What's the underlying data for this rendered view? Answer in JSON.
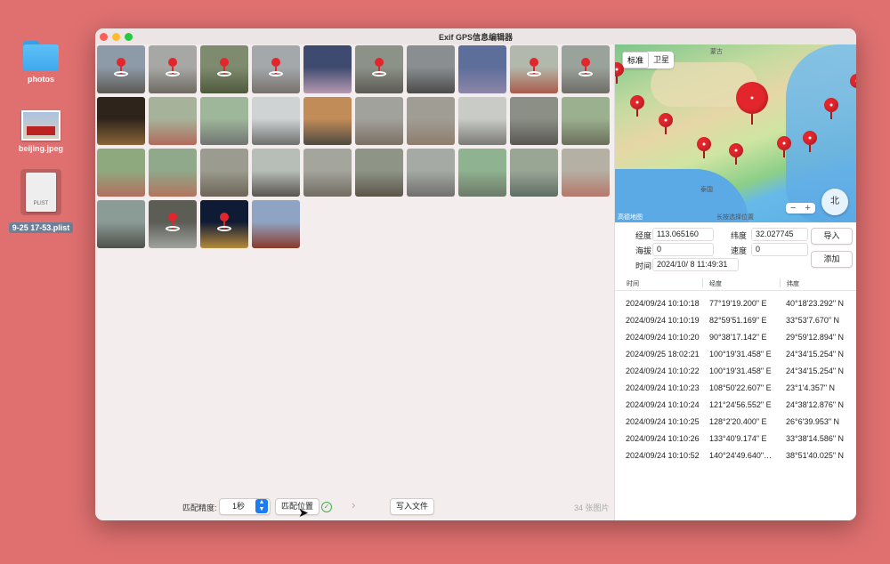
{
  "desktop": {
    "photos_label": "photos",
    "beijing_label": "beijing.jpeg",
    "plist_label": "9-25 17-53.plist",
    "plist_badge": "PLIST"
  },
  "window": {
    "title": "Exif GPS信息编辑器"
  },
  "photos": [
    {
      "pin": true,
      "colors": [
        "#8d9aa8",
        "#5d5953"
      ]
    },
    {
      "pin": true,
      "colors": [
        "#a7a8a6",
        "#6e6a62"
      ]
    },
    {
      "pin": true,
      "colors": [
        "#7f8b6e",
        "#4f5a3d"
      ]
    },
    {
      "pin": true,
      "colors": [
        "#a4a8ab",
        "#77726c"
      ]
    },
    {
      "pin": false,
      "colors": [
        "#3e4a70",
        "#b59ab0"
      ]
    },
    {
      "pin": true,
      "colors": [
        "#8c9287",
        "#5c5a55"
      ]
    },
    {
      "pin": false,
      "colors": [
        "#8a8e91",
        "#4c4b4a"
      ]
    },
    {
      "pin": false,
      "colors": [
        "#5d6e9a",
        "#8c86a8"
      ]
    },
    {
      "pin": true,
      "colors": [
        "#b2b8ab",
        "#ab5a4a"
      ]
    },
    {
      "pin": true,
      "colors": [
        "#9aa39b",
        "#6f6c66"
      ]
    },
    {
      "pin": false,
      "colors": [
        "#2e241b",
        "#8a6538"
      ]
    },
    {
      "pin": false,
      "colors": [
        "#a6b39a",
        "#b06a5b"
      ]
    },
    {
      "pin": false,
      "colors": [
        "#9eb79a",
        "#727472"
      ]
    },
    {
      "pin": false,
      "colors": [
        "#cfd3d3",
        "#6f7070"
      ]
    },
    {
      "pin": false,
      "colors": [
        "#c28c58",
        "#4f4a42"
      ]
    },
    {
      "pin": false,
      "colors": [
        "#a2a29c",
        "#7b7064"
      ]
    },
    {
      "pin": false,
      "colors": [
        "#a09e94",
        "#8e7d6c"
      ]
    },
    {
      "pin": false,
      "colors": [
        "#c8cbc6",
        "#7b7a76"
      ]
    },
    {
      "pin": false,
      "colors": [
        "#8b8f86",
        "#5a5752"
      ]
    },
    {
      "pin": false,
      "colors": [
        "#9bb08e",
        "#6b6e5c"
      ]
    },
    {
      "pin": false,
      "colors": [
        "#8fa97f",
        "#b16f5e"
      ]
    },
    {
      "pin": false,
      "colors": [
        "#8fa98a",
        "#b3745f"
      ]
    },
    {
      "pin": false,
      "colors": [
        "#9b9c8f",
        "#6d6457"
      ]
    },
    {
      "pin": false,
      "colors": [
        "#b7beb8",
        "#58554f"
      ]
    },
    {
      "pin": false,
      "colors": [
        "#a4a59d",
        "#716b61"
      ]
    },
    {
      "pin": false,
      "colors": [
        "#8e9587",
        "#5b5548"
      ]
    },
    {
      "pin": false,
      "colors": [
        "#a6aaa5",
        "#70706d"
      ]
    },
    {
      "pin": false,
      "colors": [
        "#8fb290",
        "#6d7a6a"
      ]
    },
    {
      "pin": false,
      "colors": [
        "#9aa694",
        "#5f6e66"
      ]
    },
    {
      "pin": false,
      "colors": [
        "#b5b0a4",
        "#b5786a"
      ]
    },
    {
      "pin": false,
      "colors": [
        "#8b9b95",
        "#4e514b"
      ]
    },
    {
      "pin": true,
      "colors": [
        "#5c5d55",
        "#9fa39e"
      ]
    },
    {
      "pin": true,
      "colors": [
        "#0f1a35",
        "#b58a3a"
      ]
    },
    {
      "pin": false,
      "colors": [
        "#8fa4c4",
        "#8a3a2a"
      ]
    }
  ],
  "bottom": {
    "precision_label": "匹配精度:",
    "precision_value": "1秒",
    "match_button": "匹配位置",
    "arrow": "›",
    "write_button": "写入文件",
    "count": "34 张图片"
  },
  "map": {
    "tab_standard": "标准",
    "tab_satellite": "卫星",
    "label_mongolia": "蒙古",
    "label_thailand": "泰国",
    "label_hint": "长按选择位置",
    "label_gaode": "高德地图",
    "compass": "北",
    "zoom_out": "−",
    "zoom_in": "+"
  },
  "fields": {
    "lng_label": "经度",
    "lng_value": "113.065160",
    "lat_label": "纬度",
    "lat_value": "32.027745",
    "alt_label": "海拔",
    "alt_value": "0",
    "speed_label": "速度",
    "speed_value": "0",
    "time_label": "时间",
    "time_value": "2024/10/  8 11:49:31",
    "import_button": "导入",
    "add_button": "添加"
  },
  "table": {
    "headers": [
      "时间",
      "经度",
      "纬度"
    ],
    "rows": [
      [
        "2024/09/24 10:10:18",
        "77°19'19.200\" E",
        "40°18'23.292\" N"
      ],
      [
        "2024/09/24 10:10:19",
        "82°59'51.169\" E",
        "33°53'7.670\" N"
      ],
      [
        "2024/09/24 10:10:20",
        "90°38'17.142\" E",
        "29°59'12.894\" N"
      ],
      [
        "2024/09/25 18:02:21",
        "100°19'31.458\" E",
        "24°34'15.254\" N"
      ],
      [
        "2024/09/24 10:10:22",
        "100°19'31.458\" E",
        "24°34'15.254\" N"
      ],
      [
        "2024/09/24 10:10:23",
        "108°50'22.607\" E",
        "23°1'4.357\" N"
      ],
      [
        "2024/09/24 10:10:24",
        "121°24'56.552\" E",
        "24°38'12.876\" N"
      ],
      [
        "2024/09/24 10:10:25",
        "128°2'20.400\" E",
        "26°6'39.953\" N"
      ],
      [
        "2024/09/24 10:10:26",
        "133°40'9.174\" E",
        "33°38'14.586\" N"
      ],
      [
        "2024/09/24 10:10:52",
        "140°24'49.640\"…",
        "38°51'40.025\" N"
      ]
    ]
  }
}
